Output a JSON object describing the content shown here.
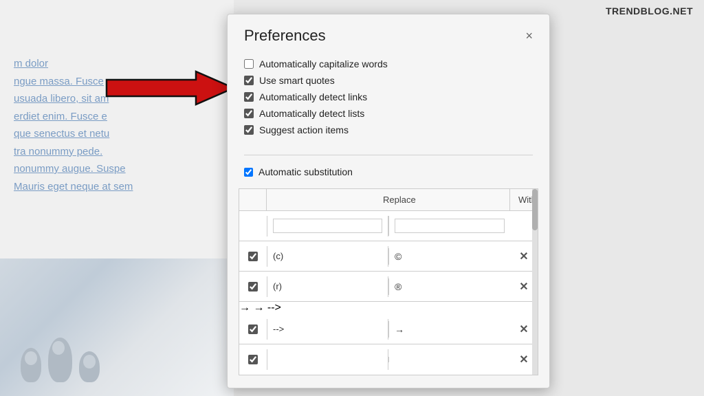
{
  "watermark": {
    "text": "TRENDBLOG.NET"
  },
  "background": {
    "text_lines": [
      "m dolor",
      "ngue massa. Fusce",
      "usuada libero, sit am",
      "erdiet enim. Fusce e",
      "que senectus et netu",
      "tra nonummy pede.",
      "nonummy augue. Suspe",
      "Mauris eget neque at sem"
    ]
  },
  "dialog": {
    "title": "Preferences",
    "close_button": "×",
    "checkboxes": [
      {
        "id": "cap",
        "label": "Automatically capitalize words",
        "checked": false
      },
      {
        "id": "quotes",
        "label": "Use smart quotes",
        "checked": true
      },
      {
        "id": "links",
        "label": "Automatically detect links",
        "checked": true
      },
      {
        "id": "lists",
        "label": "Automatically detect lists",
        "checked": true
      },
      {
        "id": "action",
        "label": "Suggest action items",
        "checked": true
      }
    ],
    "auto_sub_label": "Automatic substitution",
    "auto_sub_checked": true,
    "table": {
      "col_replace": "Replace",
      "col_with": "With",
      "rows": [
        {
          "checked": true,
          "replace": "(c)",
          "with": "©"
        },
        {
          "checked": true,
          "replace": "(r)",
          "with": "®"
        },
        {
          "checked": true,
          "replace": "-->",
          "with": "→"
        },
        {
          "checked": true,
          "replace": "",
          "with": ""
        }
      ]
    }
  }
}
